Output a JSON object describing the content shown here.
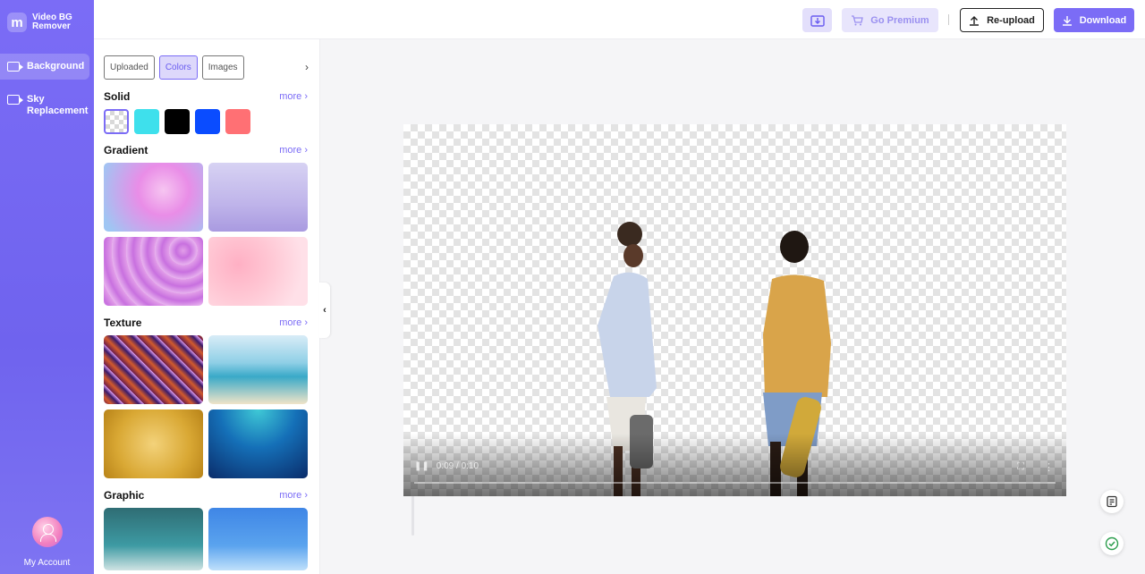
{
  "app": {
    "name": "Video BG Remover",
    "logo": "m"
  },
  "nav": {
    "items": [
      {
        "label": "Background",
        "icon": "video-icon",
        "active": true
      },
      {
        "label": "Sky Replacement",
        "icon": "video-icon",
        "active": false
      }
    ],
    "account_label": "My Account"
  },
  "toolbar": {
    "premium_label": "Go Premium",
    "reupload_label": "Re-upload",
    "download_label": "Download",
    "separator": "|"
  },
  "panel": {
    "tabs": [
      {
        "label": "Uploaded",
        "active": false
      },
      {
        "label": "Colors",
        "active": true
      },
      {
        "label": "Images",
        "active": false
      }
    ],
    "more_label": "more ›",
    "sections": {
      "solid": "Solid",
      "gradient": "Gradient",
      "texture": "Texture",
      "graphic": "Graphic"
    },
    "solid_colors": [
      "transparent",
      "#3ee0ec",
      "#000000",
      "#0a4cff",
      "#ff7074"
    ]
  },
  "player": {
    "time": "0:09 / 0:10"
  },
  "colors": {
    "accent": "#7b6cf6",
    "sidebar": "#6f63ee"
  }
}
